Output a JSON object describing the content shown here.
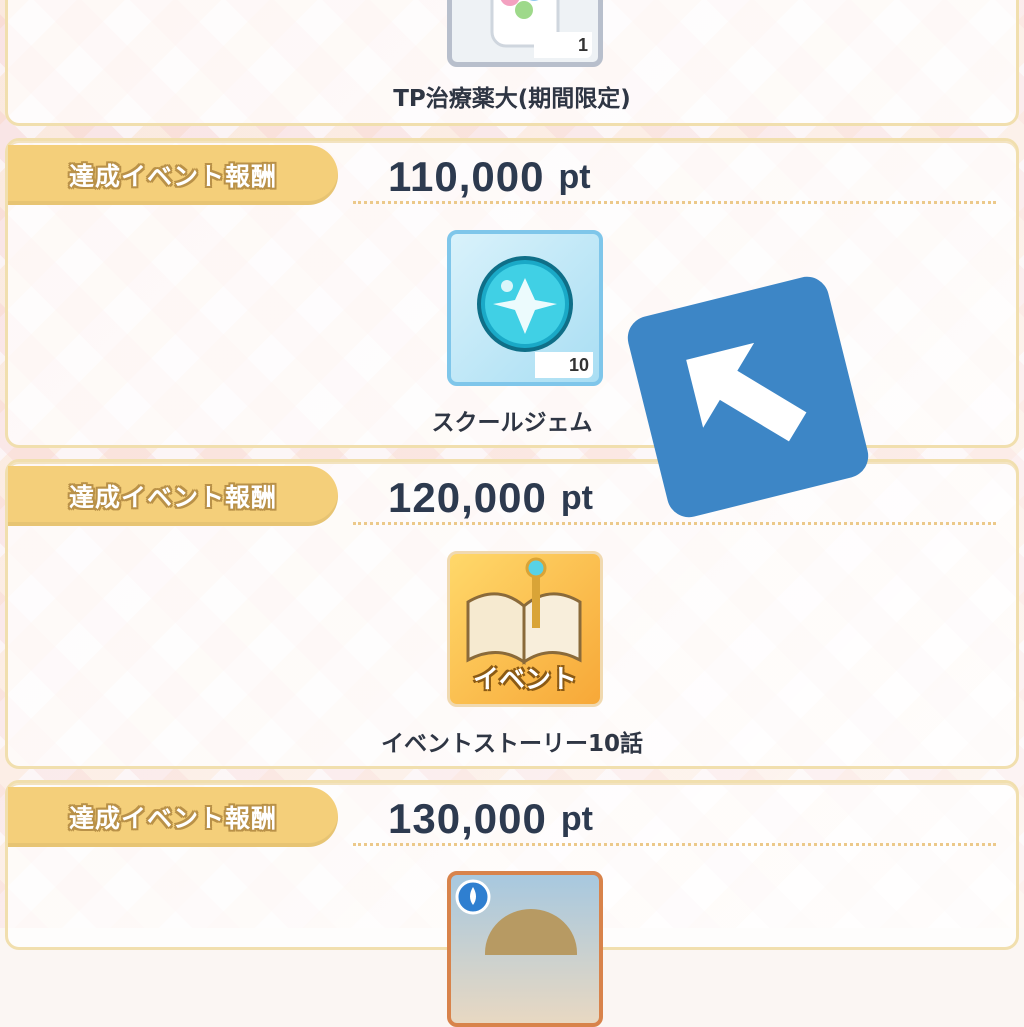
{
  "rewards": [
    {
      "item_name": "TP治療薬大(期間限定)",
      "count": "1"
    },
    {
      "ribbon": "達成イベント報酬",
      "points": "110,000",
      "unit": "pt",
      "item_name": "スクールジェム",
      "count": "10"
    },
    {
      "ribbon": "達成イベント報酬",
      "points": "120,000",
      "unit": "pt",
      "item_name": "イベントストーリー10話",
      "icon_text": "イベント"
    },
    {
      "ribbon": "達成イベント報酬",
      "points": "130,000",
      "unit": "pt"
    }
  ],
  "colors": {
    "ribbon": "#f4cf7a",
    "panel_border": "#f1dfae",
    "points_text": "#2d3a4f",
    "cursor": "#3d86c6"
  },
  "icons": {
    "potion": "tp-potion-icon",
    "gem": "school-gem-icon",
    "story": "event-story-icon",
    "card": "card-portrait-icon",
    "cursor": "pointer-arrow-icon"
  }
}
